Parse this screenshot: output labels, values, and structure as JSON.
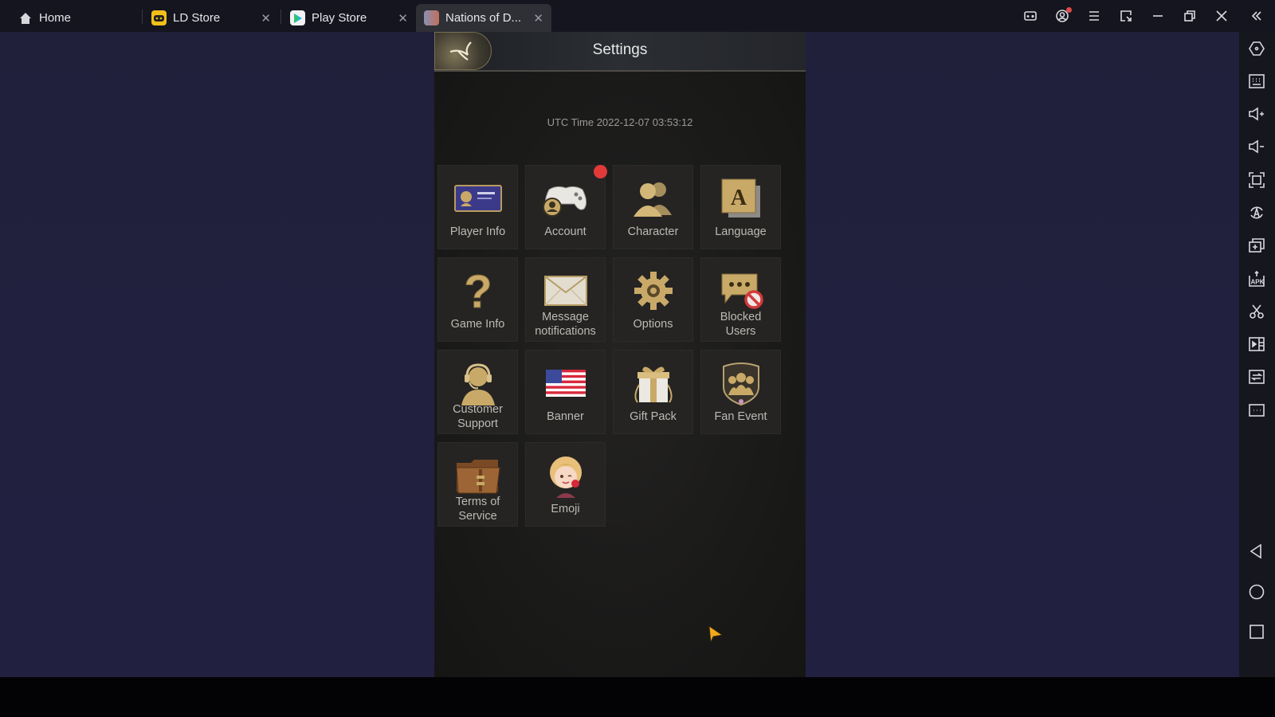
{
  "window": {
    "tabs": [
      {
        "label": "Home",
        "icon": "home-icon",
        "closable": false,
        "active": false
      },
      {
        "label": "LD Store",
        "icon": "ld-store-icon",
        "closable": true,
        "active": false
      },
      {
        "label": "Play Store",
        "icon": "play-store-icon",
        "closable": true,
        "active": false
      },
      {
        "label": "Nations of D...",
        "icon": "game-icon",
        "closable": true,
        "active": true
      }
    ],
    "close_glyph": "✕",
    "controls": [
      {
        "name": "gamepad-icon"
      },
      {
        "name": "user-account-icon",
        "has_notification": true
      },
      {
        "name": "menu-icon"
      },
      {
        "name": "window-mode-icon"
      },
      {
        "name": "minimize-icon"
      },
      {
        "name": "restore-icon"
      },
      {
        "name": "close-icon"
      },
      {
        "name": "collapse-sidebar-icon"
      }
    ]
  },
  "sidebar": {
    "items": [
      "settings-icon",
      "keyboard-icon",
      "volume-up-icon",
      "volume-down-icon",
      "fullscreen-icon",
      "auto-rotate-icon",
      "multi-instance-icon",
      "apk-install-icon",
      "screenshot-icon",
      "record-icon",
      "sync-icon",
      "more-icon"
    ],
    "apk_label": "APK",
    "nav": [
      "back-icon",
      "home-circle-icon",
      "recents-icon"
    ]
  },
  "game": {
    "title": "Settings",
    "utc_time": "UTC Time 2022-12-07 03:53:12",
    "accent": "#c9a968",
    "items": [
      {
        "label": "Player Info",
        "icon": "player-card-icon",
        "badge": false
      },
      {
        "label": "Account",
        "icon": "gamepad-account-icon",
        "badge": true
      },
      {
        "label": "Character",
        "icon": "characters-icon",
        "badge": false
      },
      {
        "label": "Language",
        "icon": "language-icon",
        "badge": false
      },
      {
        "label": "Game Info",
        "icon": "question-icon",
        "badge": false
      },
      {
        "label": "Message notifications",
        "icon": "envelope-icon",
        "badge": false
      },
      {
        "label": "Options",
        "icon": "gear-icon",
        "badge": false
      },
      {
        "label": "Blocked Users",
        "icon": "blocked-chat-icon",
        "badge": false
      },
      {
        "label": "Customer Support",
        "icon": "headset-icon",
        "badge": false
      },
      {
        "label": "Banner",
        "icon": "us-flag-icon",
        "badge": false
      },
      {
        "label": "Gift Pack",
        "icon": "gift-icon",
        "badge": false
      },
      {
        "label": "Fan Event",
        "icon": "fan-shield-icon",
        "badge": false
      },
      {
        "label": "Terms of Service",
        "icon": "folder-icon",
        "badge": false
      },
      {
        "label": "Emoji",
        "icon": "emoji-girl-icon",
        "badge": false
      }
    ],
    "item_lines": [
      [
        "Player Info"
      ],
      [
        "Account"
      ],
      [
        "Character"
      ],
      [
        "Language"
      ],
      [
        "Game Info"
      ],
      [
        "Message",
        "notifications"
      ],
      [
        "Options"
      ],
      [
        "Blocked",
        "Users"
      ],
      [
        "Customer",
        "Support"
      ],
      [
        "Banner"
      ],
      [
        "Gift Pack"
      ],
      [
        "Fan Event"
      ],
      [
        "Terms of",
        "Service"
      ],
      [
        "Emoji"
      ]
    ],
    "language_glyph": "A",
    "question_glyph": "?"
  }
}
